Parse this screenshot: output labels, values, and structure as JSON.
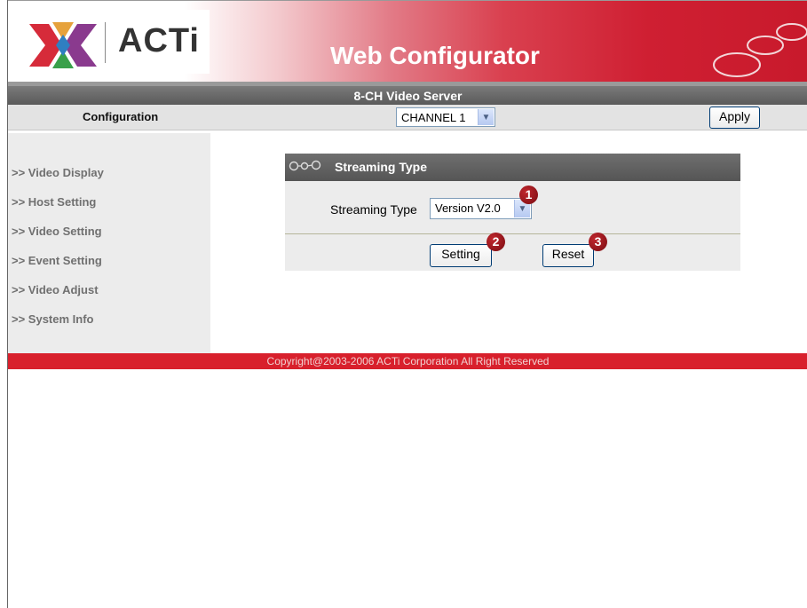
{
  "header": {
    "brand": "ACTi",
    "app_title": "Web Configurator",
    "device_name": "8-CH Video Server"
  },
  "config": {
    "label": "Configuration",
    "channel_value": "CHANNEL 1",
    "apply_label": "Apply"
  },
  "sidebar": {
    "items": [
      {
        "label": ">> Video Display"
      },
      {
        "label": ">> Host Setting"
      },
      {
        "label": ">> Video Setting"
      },
      {
        "label": ">> Event Setting"
      },
      {
        "label": ">> Video Adjust"
      },
      {
        "label": ">> System Info"
      }
    ]
  },
  "panel": {
    "title": "Streaming Type",
    "field_label": "Streaming Type",
    "stream_value": "Version V2.0",
    "setting_label": "Setting",
    "reset_label": "Reset",
    "badges": [
      "1",
      "2",
      "3"
    ]
  },
  "footer": {
    "copyright": "Copyright@2003-2006 ACTi Corporation All Right Reserved"
  },
  "colors": {
    "brand_red": "#cf1f32",
    "bar_gray": "#5a5a5a",
    "footer_red": "#d8202c"
  }
}
